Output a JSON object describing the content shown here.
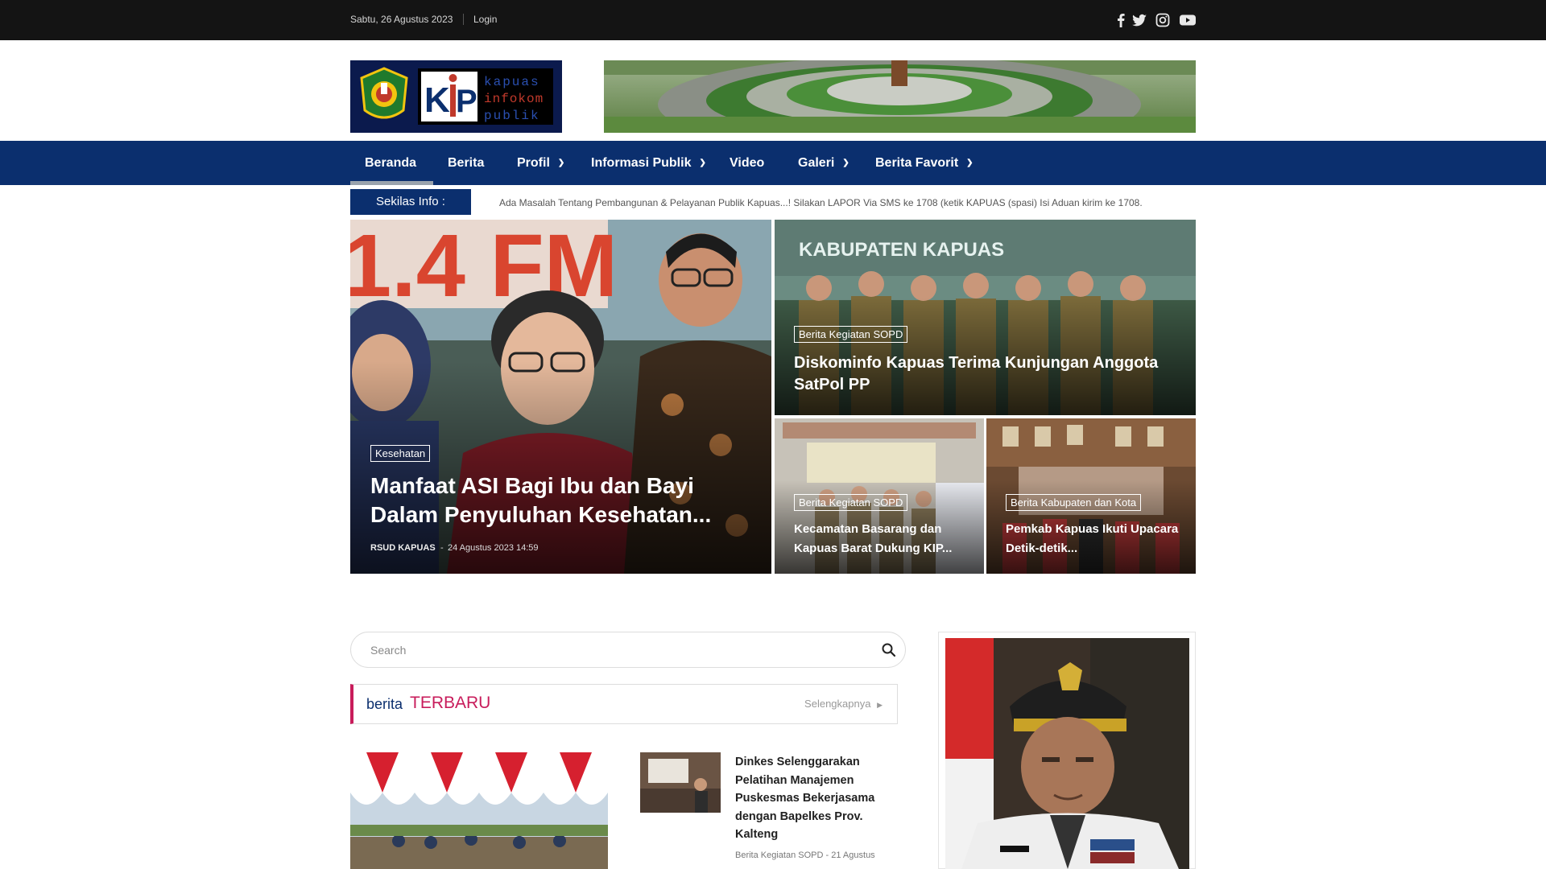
{
  "topbar": {
    "date": "Sabtu, 26 Agustus 2023",
    "login": "Login",
    "social_icons": [
      "facebook-icon",
      "twitter-icon",
      "instagram-icon",
      "youtube-icon"
    ]
  },
  "header": {
    "logo_text": [
      "kapuas",
      "infokom",
      "publik"
    ],
    "logo_mark": "KIP"
  },
  "nav": {
    "items": [
      {
        "label": "Beranda",
        "dropdown": false,
        "active": true
      },
      {
        "label": "Berita",
        "dropdown": false
      },
      {
        "label": "Profil",
        "dropdown": true
      },
      {
        "label": "Informasi Publik",
        "dropdown": true
      },
      {
        "label": "Video",
        "dropdown": false
      },
      {
        "label": "Galeri",
        "dropdown": true
      },
      {
        "label": "Berita Favorit",
        "dropdown": true
      }
    ]
  },
  "ticker": {
    "label": "Sekilas Info :",
    "text": "Ada Masalah Tentang Pembangunan & Pelayanan Publik Kapuas...! Silakan LAPOR Via SMS ke 1708 (ketik KAPUAS (spasi) Isi Aduan kirim ke 1708."
  },
  "hero": {
    "main": {
      "category": "Kesehatan",
      "title": "Manfaat ASI Bagi Ibu dan Bayi Dalam Penyuluhan Kesehatan...",
      "author": "RSUD KAPUAS",
      "date": "24 Agustus 2023 14:59",
      "photo_text": "1.4 FM"
    },
    "top_right": {
      "category": "Berita Kegiatan SOPD",
      "title": "Diskominfo Kapuas Terima Kunjungan Anggota SatPol PP",
      "photo_text": "KABUPATEN KAPUAS"
    },
    "bottom_left": {
      "category": "Berita Kegiatan SOPD",
      "title": "Kecamatan Basarang dan Kapuas Barat Dukung KIP..."
    },
    "bottom_right": {
      "category": "Berita Kabupaten dan Kota",
      "title": "Pemkab Kapuas Ikuti Upacara Detik-detik..."
    }
  },
  "search": {
    "placeholder": "Search"
  },
  "section": {
    "title_part1": "berita",
    "title_part2": "TERBARU",
    "more": "Selengkapnya"
  },
  "news": {
    "item": {
      "title": "Dinkes Selenggarakan Pelatihan Manajemen Puskesmas Bekerjasama dengan Bapelkes Prov. Kalteng",
      "category": "Berita Kegiatan SOPD",
      "date": "21 Agustus"
    }
  },
  "colors": {
    "topbar": "#141414",
    "nav": "#0b2f6e",
    "accent": "#c81c5b"
  }
}
